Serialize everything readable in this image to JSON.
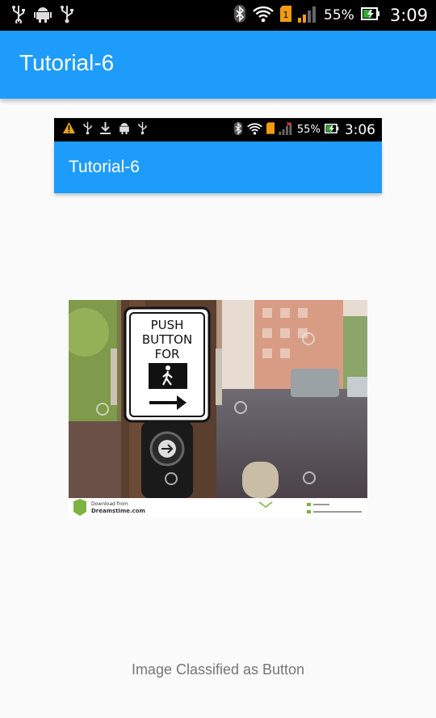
{
  "status_bar": {
    "left_icons": [
      "usb-icon",
      "android-icon",
      "usb-icon"
    ],
    "right_icons": [
      "bluetooth-icon",
      "wifi-icon",
      "sim-1-icon",
      "signal-icon"
    ],
    "battery_text": "55%",
    "time": "3:09"
  },
  "app_bar": {
    "title": "Tutorial-6",
    "color": "#1e9cfb"
  },
  "embedded_screenshot": {
    "status_bar": {
      "left_icons": [
        "warning-icon",
        "usb-icon",
        "download-icon",
        "android-icon",
        "usb-icon"
      ],
      "battery_text": "55%",
      "time": "3:06"
    },
    "app_bar": {
      "title": "Tutorial-6"
    }
  },
  "image": {
    "sign_line1": "PUSH",
    "sign_line2": "BUTTON",
    "sign_line3": "FOR",
    "footer_download": "Download from",
    "footer_brand": "Dreamstime.com"
  },
  "caption": "Image Classified as Button"
}
